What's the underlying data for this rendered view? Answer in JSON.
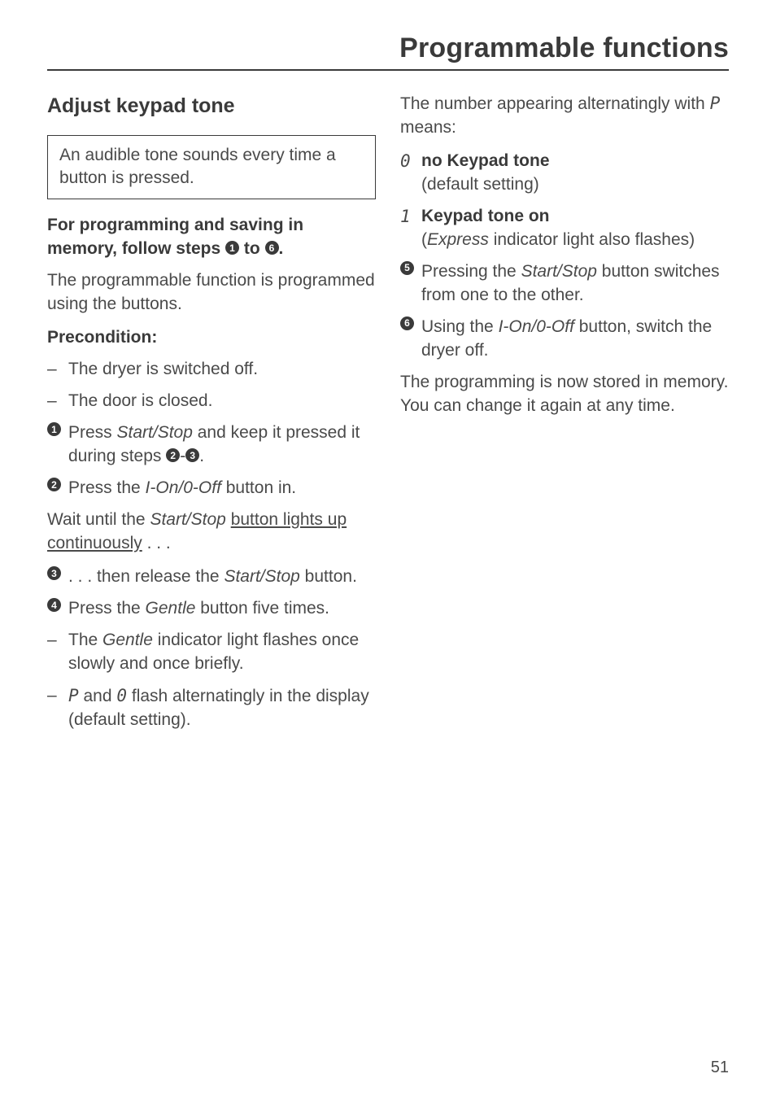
{
  "page_title": "Programmable functions",
  "page_number": "51",
  "left": {
    "section_heading": "Adjust keypad tone",
    "boxed_text": "An audible tone sounds every time a button is pressed.",
    "bold_lead_1": "For programming and saving in memory, follow steps ",
    "bold_lead_2": " to ",
    "bold_lead_3": ".",
    "lead_num_a": "1",
    "lead_num_b": "6",
    "para_after_lead": "The programmable function is programmed using the buttons.",
    "precondition_heading": "Precondition:",
    "dash_a": "The dryer is switched off.",
    "dash_b": "The door is closed.",
    "step1_a": "Press ",
    "step1_b": "Start/Stop",
    "step1_c": " and keep it pressed it during steps ",
    "step1_d": "-",
    "step1_e": ".",
    "step1_num_x": "2",
    "step1_num_y": "3",
    "step2_a": "Press the ",
    "step2_b": "I-On/0-Off",
    "step2_c": " button in.",
    "wait_a": "Wait until the ",
    "wait_b": "Start/Stop",
    "wait_c": " button lights up continuously",
    "wait_d": " . . .",
    "step3_a": ". . . then release the ",
    "step3_b": "Start/Stop",
    "step3_c": " button.",
    "step4_a": "Press the ",
    "step4_b": "Gentle",
    "step4_c": " button five times.",
    "dash_c_a": "The ",
    "dash_c_b": "Gentle",
    "dash_c_c": " indicator light flashes once  slowly and once briefly.",
    "dash_d_a": " ",
    "dash_d_p": "P",
    "dash_d_b": " and ",
    "dash_d_zero": "0",
    "dash_d_c": " flash alternatingly in the display (default setting).",
    "step_nums": {
      "s1": "1",
      "s2": "2",
      "s3": "3",
      "s4": "4"
    }
  },
  "right": {
    "intro_a": "The number appearing alternatingly with ",
    "intro_p": "P",
    "intro_b": " means:",
    "m0_sym": "0",
    "m0_title": "no Keypad tone",
    "m0_sub": "(default setting)",
    "m1_sym": "1",
    "m1_title": "Keypad tone on",
    "m1_sub_a": "(",
    "m1_sub_b": "Express",
    "m1_sub_c": " indicator light also flashes)",
    "step5_a": "Pressing the ",
    "step5_b": "Start/Stop",
    "step5_c": " button switches from one to the other.",
    "step6_a": "Using the ",
    "step6_b": "I-On/0-Off",
    "step6_c": " button, switch the dryer off.",
    "outro": "The programming is now stored in memory. You can change it again at any time.",
    "step_nums": {
      "s5": "5",
      "s6": "6"
    }
  }
}
